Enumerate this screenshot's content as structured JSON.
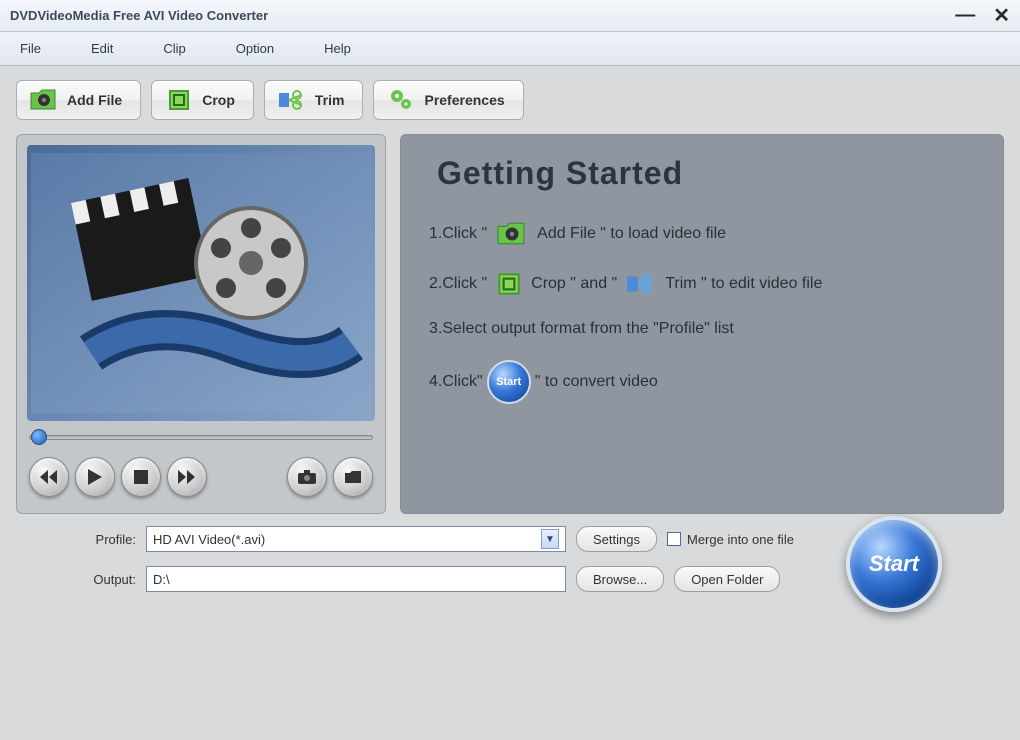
{
  "window": {
    "title": "DVDVideoMedia Free AVI Video Converter"
  },
  "menu": {
    "file": "File",
    "edit": "Edit",
    "clip": "Clip",
    "option": "Option",
    "help": "Help"
  },
  "toolbar": {
    "add_file": "Add File",
    "crop": "Crop",
    "trim": "Trim",
    "preferences": "Preferences"
  },
  "help": {
    "title": "Getting Started",
    "step1_a": "1.Click \"",
    "step1_b": "Add File \" to load video file",
    "step2_a": "2.Click \"",
    "step2_b": " Crop \" and \"",
    "step2_c": " Trim \" to edit video file",
    "step3": "3.Select output format from the \"Profile\" list",
    "step4_a": "4.Click\"",
    "step4_b": "\" to convert video",
    "start_mini": "Start"
  },
  "bottom": {
    "profile_label": "Profile:",
    "profile_value": "HD AVI Video(*.avi)",
    "output_label": "Output:",
    "output_value": "D:\\",
    "settings": "Settings",
    "browse": "Browse...",
    "open_folder": "Open Folder",
    "merge": "Merge into one file",
    "start": "Start"
  }
}
